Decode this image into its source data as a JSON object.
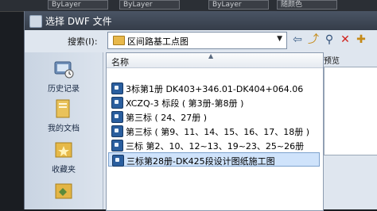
{
  "background": {
    "combo_1": "ByLayer",
    "combo_2": "ByLayer",
    "combo_3": "ByLayer",
    "combo_4": "随颜色"
  },
  "dialog": {
    "title": "选择 DWF 文件",
    "look_in_label": "搜索(I):",
    "look_in_value": "区间路基工点图"
  },
  "places": [
    {
      "label": "历史记录",
      "icon": "history-icon"
    },
    {
      "label": "我的文档",
      "icon": "documents-icon"
    },
    {
      "label": "收藏夹",
      "icon": "favorites-icon"
    },
    {
      "label": "",
      "icon": "ftp-icon"
    }
  ],
  "filelist": {
    "column_name": "名称",
    "items": [
      {
        "name": "3标第1册  DK403+346.01-DK404+064.06",
        "selected": false
      },
      {
        "name": "XCZQ-3 标段 ( 第3册-第8册 )",
        "selected": false
      },
      {
        "name": "第三标 ( 24、27册 )",
        "selected": false
      },
      {
        "name": "第三标 ( 第9、11、14、15、16、17、18册 )",
        "selected": false
      },
      {
        "name": "三标 第2、10、12~13、19~23、25~26册",
        "selected": false
      },
      {
        "name": "三标第28册-DK425段设计图纸施工图",
        "selected": true
      }
    ]
  },
  "preview": {
    "label": "预览"
  }
}
